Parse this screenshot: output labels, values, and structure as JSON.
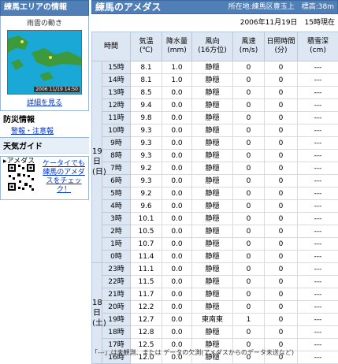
{
  "sidebar": {
    "header": "練馬エリアの情報",
    "radar_title": "雨雲の動き",
    "radar_stamp": "2006 11/19 14:50",
    "details_link": "詳細を見る",
    "disaster_title": "防災情報",
    "alerts_link": "警報・注意報",
    "guide_title": "天気ガイド",
    "guide_item": "▸アメダス",
    "mobile_text": "ケータイでも練馬のアメダスをチェック！"
  },
  "main": {
    "title": "練馬のアメダス",
    "location": "所在地:練馬区豊玉上　標高:38m",
    "date": "2006年11月19日　15時現在",
    "columns": [
      "時間",
      "気温\n(℃)",
      "降水量\n(mm)",
      "風向\n(16方位)",
      "風速\n(m/s)",
      "日照時間\n(分)",
      "積雪深\n(cm)"
    ],
    "days": [
      {
        "label": "19日\n(日)",
        "rows": [
          {
            "hour": "15時",
            "temp": "8.1",
            "precip": "1.0",
            "dir": "静穏",
            "speed": "0",
            "sun": "0",
            "snow": "---"
          },
          {
            "hour": "14時",
            "temp": "8.1",
            "precip": "1.0",
            "dir": "静穏",
            "speed": "0",
            "sun": "0",
            "snow": "---"
          },
          {
            "hour": "13時",
            "temp": "8.5",
            "precip": "0.0",
            "dir": "静穏",
            "speed": "0",
            "sun": "0",
            "snow": "---"
          },
          {
            "hour": "12時",
            "temp": "9.4",
            "precip": "0.0",
            "dir": "静穏",
            "speed": "0",
            "sun": "0",
            "snow": "---"
          },
          {
            "hour": "11時",
            "temp": "9.8",
            "precip": "0.0",
            "dir": "静穏",
            "speed": "0",
            "sun": "0",
            "snow": "---"
          },
          {
            "hour": "10時",
            "temp": "9.3",
            "precip": "0.0",
            "dir": "静穏",
            "speed": "0",
            "sun": "0",
            "snow": "---"
          },
          {
            "hour": "9時",
            "temp": "9.3",
            "precip": "0.0",
            "dir": "静穏",
            "speed": "0",
            "sun": "0",
            "snow": "---"
          },
          {
            "hour": "8時",
            "temp": "9.3",
            "precip": "0.0",
            "dir": "静穏",
            "speed": "0",
            "sun": "0",
            "snow": "---"
          },
          {
            "hour": "7時",
            "temp": "9.2",
            "precip": "0.0",
            "dir": "静穏",
            "speed": "0",
            "sun": "0",
            "snow": "---"
          },
          {
            "hour": "6時",
            "temp": "9.3",
            "precip": "0.0",
            "dir": "静穏",
            "speed": "0",
            "sun": "0",
            "snow": "---"
          },
          {
            "hour": "5時",
            "temp": "9.2",
            "precip": "0.0",
            "dir": "静穏",
            "speed": "0",
            "sun": "0",
            "snow": "---"
          },
          {
            "hour": "4時",
            "temp": "9.6",
            "precip": "0.0",
            "dir": "静穏",
            "speed": "0",
            "sun": "0",
            "snow": "---"
          },
          {
            "hour": "3時",
            "temp": "10.1",
            "precip": "0.0",
            "dir": "静穏",
            "speed": "0",
            "sun": "0",
            "snow": "---"
          },
          {
            "hour": "2時",
            "temp": "10.5",
            "precip": "0.0",
            "dir": "静穏",
            "speed": "0",
            "sun": "0",
            "snow": "---"
          },
          {
            "hour": "1時",
            "temp": "10.7",
            "precip": "0.0",
            "dir": "静穏",
            "speed": "0",
            "sun": "0",
            "snow": "---"
          },
          {
            "hour": "0時",
            "temp": "11.4",
            "precip": "0.0",
            "dir": "静穏",
            "speed": "0",
            "sun": "0",
            "snow": "---"
          }
        ]
      },
      {
        "label": "18日\n(土)",
        "rows": [
          {
            "hour": "23時",
            "temp": "11.1",
            "precip": "0.0",
            "dir": "静穏",
            "speed": "0",
            "sun": "0",
            "snow": "---"
          },
          {
            "hour": "22時",
            "temp": "11.5",
            "precip": "0.0",
            "dir": "静穏",
            "speed": "0",
            "sun": "0",
            "snow": "---"
          },
          {
            "hour": "21時",
            "temp": "11.7",
            "precip": "0.0",
            "dir": "静穏",
            "speed": "0",
            "sun": "0",
            "snow": "---"
          },
          {
            "hour": "20時",
            "temp": "12.2",
            "precip": "0.0",
            "dir": "静穏",
            "speed": "0",
            "sun": "0",
            "snow": "---"
          },
          {
            "hour": "19時",
            "temp": "12.7",
            "precip": "0.0",
            "dir": "東南東",
            "speed": "1",
            "sun": "0",
            "snow": "---"
          },
          {
            "hour": "18時",
            "temp": "12.8",
            "precip": "0.0",
            "dir": "静穏",
            "speed": "0",
            "sun": "0",
            "snow": "---"
          },
          {
            "hour": "17時",
            "temp": "12.5",
            "precip": "0.0",
            "dir": "静穏",
            "speed": "0",
            "sun": "0",
            "snow": "---"
          },
          {
            "hour": "16時",
            "temp": "12.0",
            "precip": "0.0",
            "dir": "静穏",
            "speed": "0",
            "sun": "0",
            "snow": "---"
          }
        ]
      }
    ],
    "footnote": "「---」は未観測、または データの欠測(アメダスからのデータ未送など)"
  }
}
